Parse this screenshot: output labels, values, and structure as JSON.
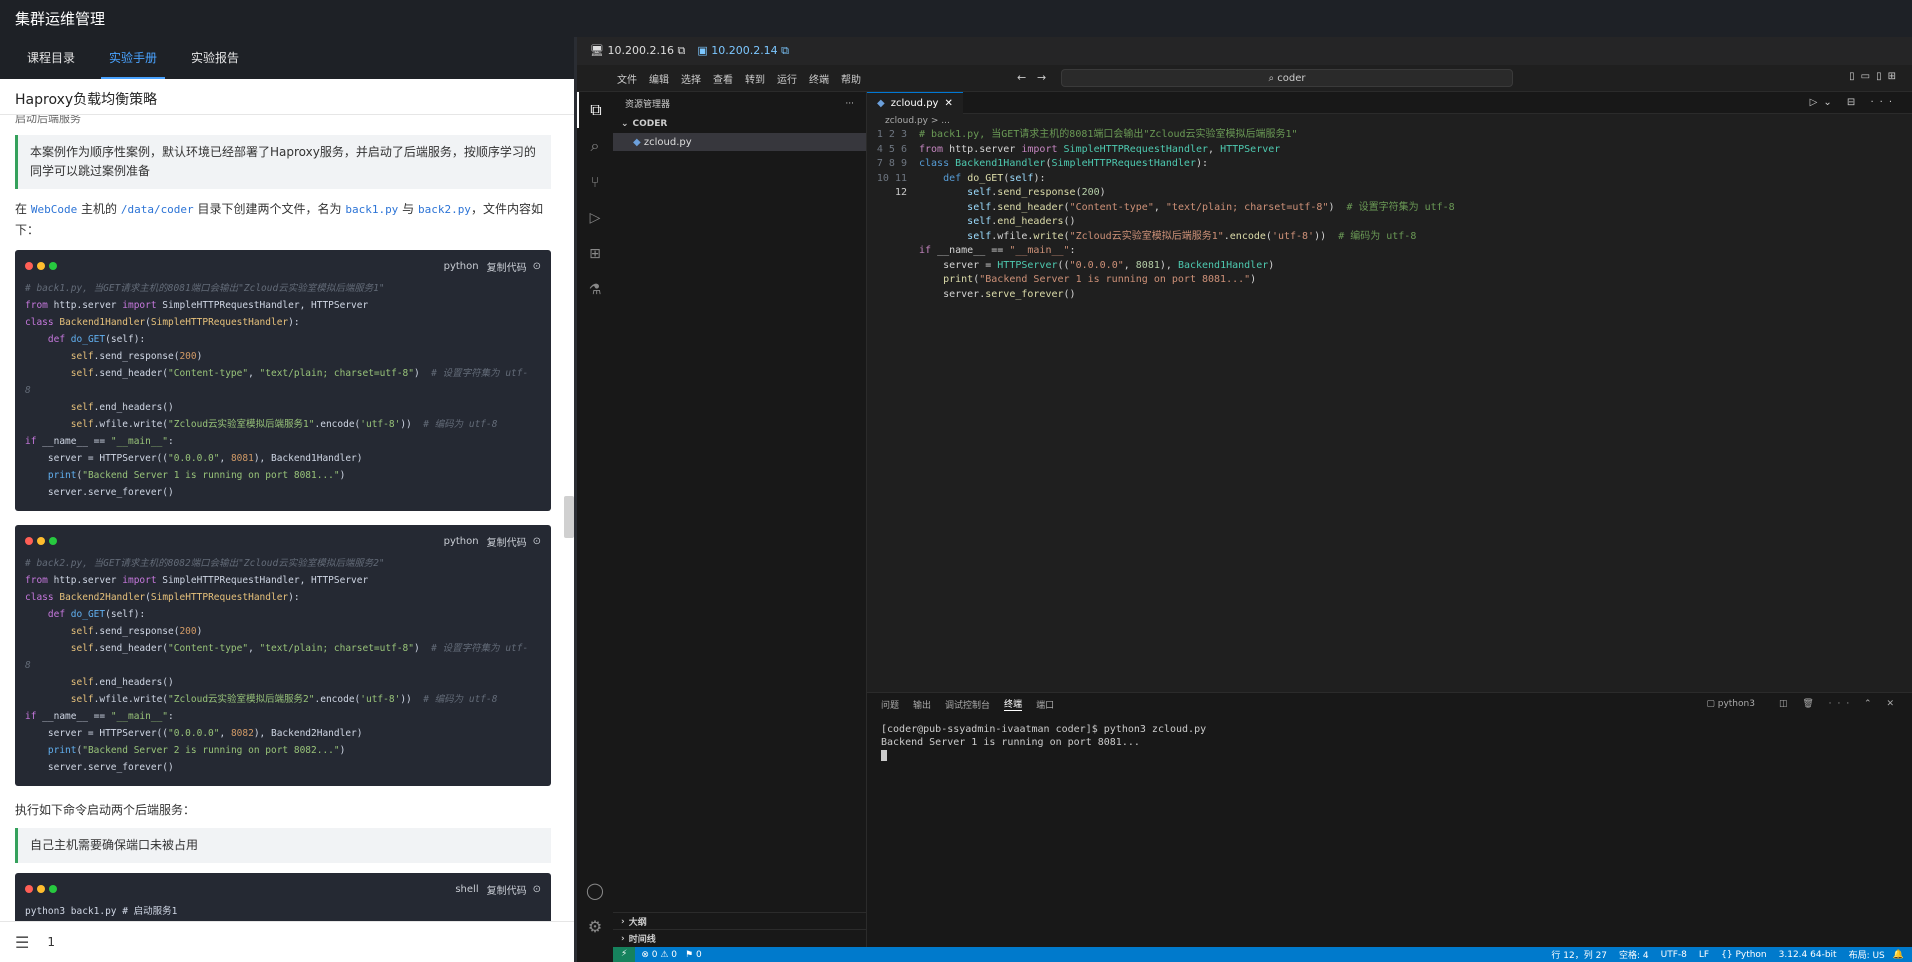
{
  "app": {
    "title": "集群运维管理"
  },
  "left": {
    "tabs": [
      "课程目录",
      "实验手册",
      "实验报告"
    ],
    "active_tab": 1,
    "doc_title": "Haproxy负载均衡策略",
    "cut_heading": "启动后端服务",
    "note1": "本案例作为顺序性案例，默认环境已经部署了Haproxy服务，并启动了后端服务，按顺序学习的同学可以跳过案例准备",
    "intro": {
      "p1": "在 ",
      "host": "WebCode",
      "p2": " 主机的 ",
      "path": "/data/coder",
      "p3": " 目录下创建两个文件，名为 ",
      "f1": "back1.py",
      "p4": " 与 ",
      "f2": "back2.py",
      "p5": "，文件内容如下："
    },
    "code_lang_py": "python",
    "code_lang_sh": "shell",
    "copy_label": "复制代码",
    "run_text": "执行如下命令启动两个后端服务：",
    "note2": "自己主机需要确保端口未被占用",
    "shell_first": "python3 back1.py # 启动服务1",
    "footer_num": "1"
  },
  "remote": {
    "ip1": "10.200.2.16",
    "ip2": "10.200.2.14"
  },
  "vscode": {
    "menus": [
      "文件",
      "编辑",
      "选择",
      "查看",
      "转到",
      "运行",
      "终端",
      "帮助"
    ],
    "search": "coder",
    "explorer_title": "资源管理器",
    "folder": "CODER",
    "file": "zcloud.py",
    "tab": "zcloud.py",
    "breadcrumb": "zcloud.py > ...",
    "outline": "大纲",
    "timeline": "时间线",
    "panel_tabs": [
      "问题",
      "输出",
      "调试控制台",
      "终端",
      "端口"
    ],
    "terminal_name": "python3",
    "terminal": [
      "[coder@pub-ssyadmin-ivaatman coder]$ python3 zcloud.py",
      "Backend Server 1 is running on port 8081..."
    ],
    "status": {
      "pos": "行 12，列 27",
      "spaces": "空格: 4",
      "enc": "UTF-8",
      "eol": "LF",
      "lang": "Python",
      "ver": "3.12.4 64-bit",
      "layout": "布局: US",
      "errors": "0",
      "warnings": "0",
      "ports": "0"
    }
  }
}
